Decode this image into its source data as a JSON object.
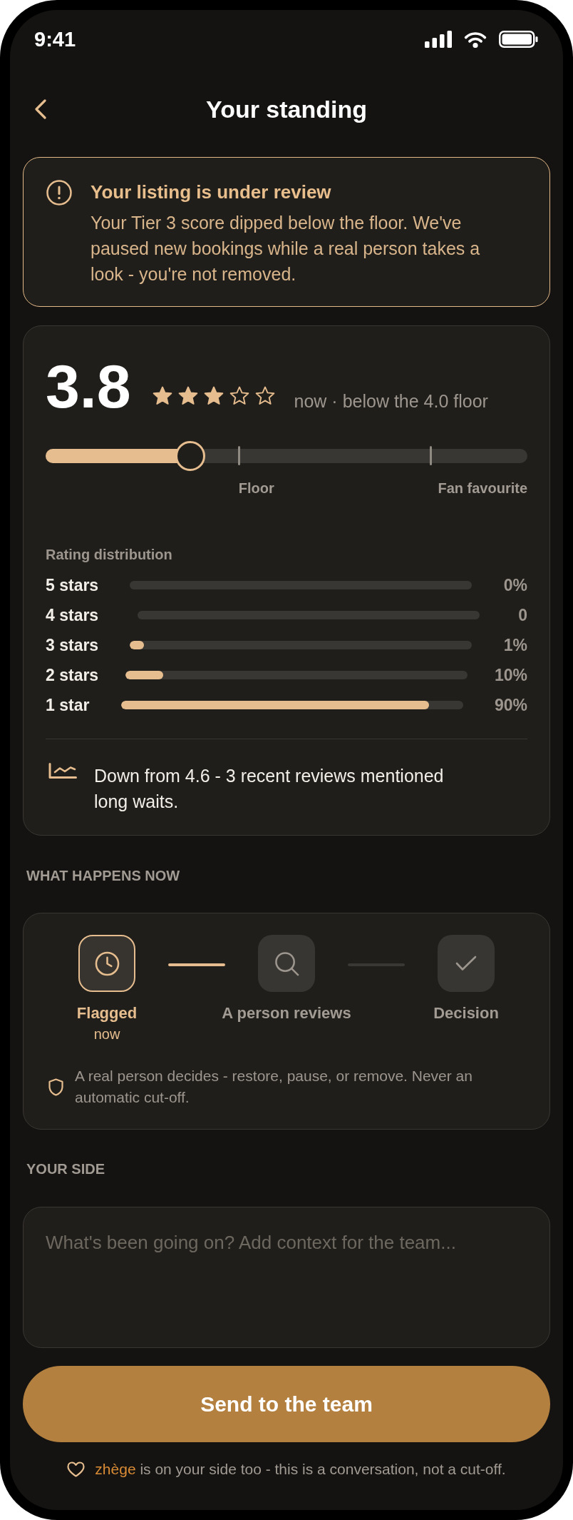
{
  "status_bar": {
    "time": "9:41"
  },
  "header": {
    "title": "Your standing"
  },
  "alert": {
    "title": "Your listing is under review",
    "message": "Your Tier 3 score dipped below the floor. We've paused new bookings while a real person takes a look - you're not removed."
  },
  "rating": {
    "score": "3.8",
    "stars": 3,
    "caption": "now · below the 4.0 floor",
    "scale": {
      "level": 0.3,
      "markers": [
        {
          "label": "Floor"
        },
        {
          "label": "Fan favourite"
        }
      ]
    },
    "distribution": {
      "title": "Rating distribution",
      "rows": [
        {
          "label": "5 stars",
          "value": "0%"
        },
        {
          "label": "4 stars",
          "value": "0"
        },
        {
          "label": "3 stars",
          "level": 0.04,
          "value": "1%"
        },
        {
          "label": "2 stars",
          "level": 0.11,
          "value": "10%"
        },
        {
          "label": "1 star",
          "level": 0.9,
          "value": "90%"
        }
      ]
    },
    "trend": "Down from 4.6 - 3 recent reviews mentioned long waits."
  },
  "process": {
    "heading": "WHAT HAPPENS NOW",
    "steps": [
      {
        "label": "Flagged",
        "note": "now",
        "active": true
      },
      {
        "label": "A person reviews",
        "active": false
      },
      {
        "label": "Decision",
        "active": false
      }
    ],
    "note": "A real person decides - restore, pause, or remove. Never an automatic cut-off."
  },
  "your_side": {
    "heading": "YOUR SIDE",
    "placeholder": "What's been going on? Add context for the team..."
  },
  "submit": {
    "label": "Send to the team"
  },
  "footer": {
    "brand": "zhège",
    "text": "is on your side too - this is a conversation, not a cut-off."
  }
}
